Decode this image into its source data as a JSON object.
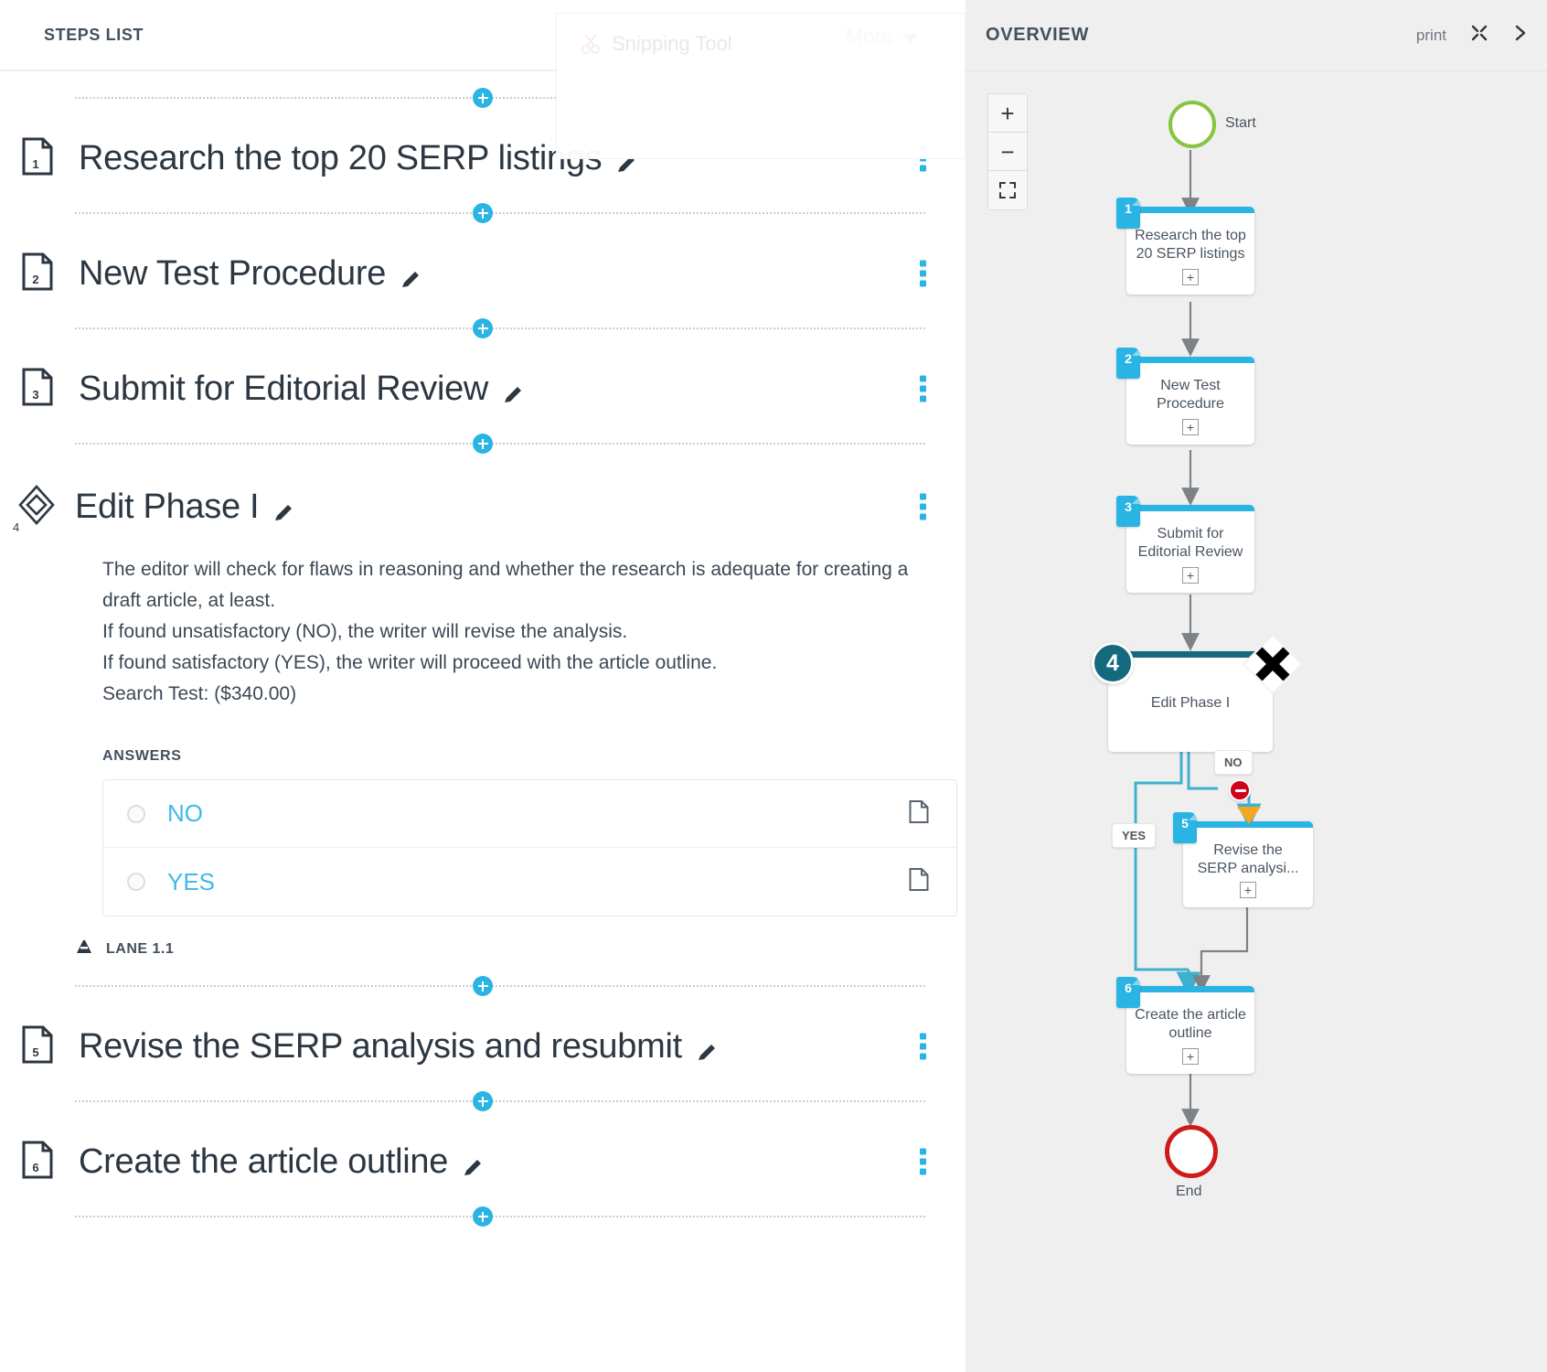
{
  "steps_panel": {
    "header_title": "STEPS LIST",
    "more_label": "More",
    "ghost_window_title": "Snipping Tool",
    "lane_label": "LANE 1.1",
    "answers_label": "ANSWERS",
    "steps": [
      {
        "number": "1",
        "title": "Research the top 20 SERP listings",
        "type": "task"
      },
      {
        "number": "2",
        "title": "New Test Procedure",
        "type": "task"
      },
      {
        "number": "3",
        "title": "Submit for Editorial Review",
        "type": "task"
      },
      {
        "number": "4",
        "title": "Edit Phase I",
        "type": "gateway"
      },
      {
        "number": "5",
        "title": "Revise the SERP analysis and resubmit",
        "type": "task"
      },
      {
        "number": "6",
        "title": "Create the article outline",
        "type": "task"
      }
    ],
    "step4_description": [
      "The editor will check for flaws in reasoning and whether the research is adequate for creating a",
      "draft article, at least.",
      "If found unsatisfactory (NO), the writer will revise the analysis.",
      "If found satisfactory (YES), the writer will proceed with the article outline.",
      "Search Test: ($340.00)"
    ],
    "answers": [
      {
        "label": "NO"
      },
      {
        "label": "YES"
      }
    ]
  },
  "overview_panel": {
    "header_title": "OVERVIEW",
    "print_label": "print",
    "zoom_in_label": "+",
    "zoom_out_label": "−",
    "fit_label": "fit-screen",
    "start_label": "Start",
    "end_label": "End",
    "nodes": [
      {
        "number": "1",
        "label": "Research the top\n20 SERP listings"
      },
      {
        "number": "2",
        "label": "New Test\nProcedure"
      },
      {
        "number": "3",
        "label": "Submit for\nEditorial Review"
      },
      {
        "number": "4",
        "label": "Edit Phase I"
      },
      {
        "number": "5",
        "label": "Revise the\nSERP analysi..."
      },
      {
        "number": "6",
        "label": "Create the article\noutline"
      }
    ],
    "edge_labels": {
      "no": "NO",
      "yes": "YES"
    }
  },
  "colors": {
    "accent": "#29b4e3",
    "gateway": "#136a7f",
    "start": "#86c440",
    "end": "#cf1a1a",
    "warn": "#f5a623",
    "stop": "#d0021b"
  }
}
